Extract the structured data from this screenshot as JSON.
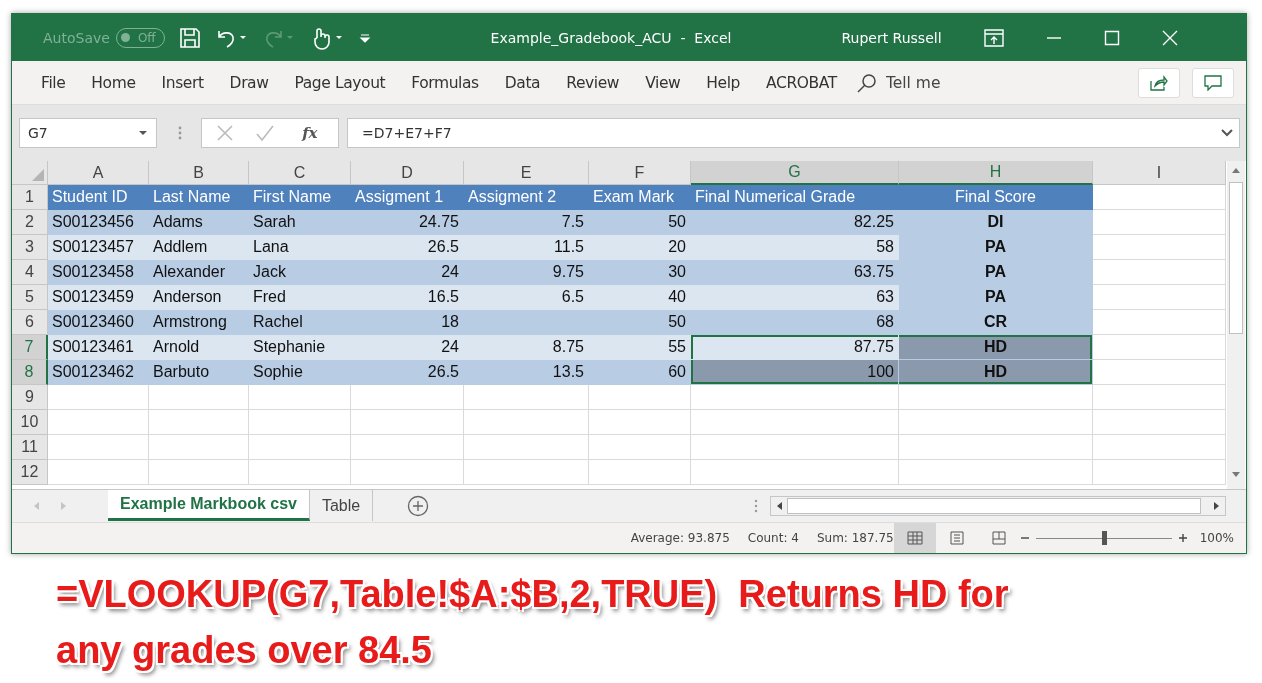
{
  "window": {
    "autosave": {
      "label": "AutoSave",
      "on": false,
      "state_label": "Off"
    },
    "title": "Example_Gradebook_ACU  -  Excel",
    "user": "Rupert Russell"
  },
  "ribbon_tabs": [
    {
      "label": "File"
    },
    {
      "label": "Home"
    },
    {
      "label": "Insert"
    },
    {
      "label": "Draw"
    },
    {
      "label": "Page Layout"
    },
    {
      "label": "Formulas"
    },
    {
      "label": "Data"
    },
    {
      "label": "Review"
    },
    {
      "label": "View"
    },
    {
      "label": "Help"
    },
    {
      "label": "ACROBAT"
    }
  ],
  "tell_me": {
    "placeholder": "Tell me"
  },
  "formula_bar": {
    "name_box": "G7",
    "fx": "fx",
    "formula": "=D7+E7+F7"
  },
  "columns": [
    {
      "label": "A",
      "kind": "text",
      "selected": false,
      "active": false
    },
    {
      "label": "B",
      "kind": "text",
      "selected": false,
      "active": false
    },
    {
      "label": "C",
      "kind": "text",
      "selected": false,
      "active": false
    },
    {
      "label": "D",
      "kind": "number",
      "selected": false,
      "active": false
    },
    {
      "label": "E",
      "kind": "number",
      "selected": false,
      "active": false
    },
    {
      "label": "F",
      "kind": "number",
      "selected": false,
      "active": false
    },
    {
      "label": "G",
      "kind": "number",
      "selected": true,
      "active": true
    },
    {
      "label": "H",
      "kind": "grade",
      "selected": true,
      "active": false
    },
    {
      "label": "I",
      "kind": "text",
      "selected": false,
      "active": false
    }
  ],
  "rows": [
    {
      "header": "1",
      "kind": "table-header",
      "selected": false,
      "active": false,
      "cells": [
        "Student ID",
        "Last Name",
        "First Name",
        "Assigment 1",
        "Assigment 2",
        "Exam Mark",
        "Final Numerical Grade",
        "Final Score"
      ]
    },
    {
      "header": "2",
      "kind": "data",
      "selected": false,
      "active": false,
      "cells": [
        "S00123456",
        "Adams",
        "Sarah",
        "24.75",
        "7.5",
        "50",
        "82.25",
        "DI"
      ]
    },
    {
      "header": "3",
      "kind": "data",
      "selected": false,
      "active": false,
      "cells": [
        "S00123457",
        "Addlem",
        "Lana",
        "26.5",
        "11.5",
        "20",
        "58",
        "PA"
      ]
    },
    {
      "header": "4",
      "kind": "data",
      "selected": false,
      "active": false,
      "cells": [
        "S00123458",
        "Alexander",
        "Jack",
        "24",
        "9.75",
        "30",
        "63.75",
        "PA"
      ]
    },
    {
      "header": "5",
      "kind": "data",
      "selected": false,
      "active": false,
      "cells": [
        "S00123459",
        "Anderson",
        "Fred",
        "16.5",
        "6.5",
        "40",
        "63",
        "PA"
      ]
    },
    {
      "header": "6",
      "kind": "data",
      "selected": false,
      "active": false,
      "cells": [
        "S00123460",
        "Armstrong",
        "Rachel",
        "18",
        null,
        "50",
        "68",
        "CR"
      ]
    },
    {
      "header": "7",
      "kind": "data",
      "selected": true,
      "active": true,
      "cells": [
        "S00123461",
        "Arnold",
        "Stephanie",
        "24",
        "8.75",
        "55",
        "87.75",
        "HD"
      ]
    },
    {
      "header": "8",
      "kind": "data",
      "selected": true,
      "active": false,
      "cells": [
        "S00123462",
        "Barbuto",
        "Sophie",
        "26.5",
        "13.5",
        "60",
        "100",
        "HD"
      ]
    },
    {
      "header": "9",
      "kind": "empty",
      "selected": false,
      "active": false
    },
    {
      "header": "10",
      "kind": "empty",
      "selected": false,
      "active": false
    },
    {
      "header": "11",
      "kind": "empty",
      "selected": false,
      "active": false
    },
    {
      "header": "12",
      "kind": "empty",
      "selected": false,
      "active": false
    }
  ],
  "sheet_tabs": [
    {
      "label": "Example Markbook csv",
      "selected": true
    },
    {
      "label": "Table",
      "selected": false
    }
  ],
  "status_bar": {
    "stats": [
      "Average: 93.875",
      "Count: 4",
      "Sum: 187.75"
    ],
    "views": [
      {
        "kind": "normal",
        "selected": true
      },
      {
        "kind": "page-layout",
        "selected": false
      },
      {
        "kind": "page-break",
        "selected": false
      }
    ],
    "zoom": {
      "level": 0.5,
      "reading": "100%"
    }
  },
  "caption": "=VLOOKUP(G7,Table!$A:$B,2,TRUE)  Returns HD for any grades over 84.5"
}
